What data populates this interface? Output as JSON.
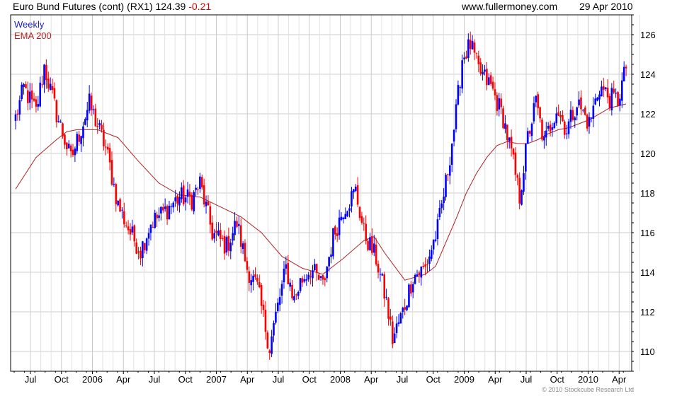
{
  "header": {
    "title": "Euro Bund Futures (cont) (RX1) 124.39",
    "change": "-0.21",
    "site": "www.fullermoney.com",
    "date": "29 Apr 2010"
  },
  "legend": [
    {
      "label": "Weekly",
      "color": "#1f1fbf"
    },
    {
      "label": "EMA 200",
      "color": "#b22222"
    }
  ],
  "copyright": "© 2010 Stockcube Research Ltd",
  "colors": {
    "up": "#0000ff",
    "down": "#ff0000",
    "ema": "#b22222",
    "grid": "#cccccc"
  },
  "chart_data": {
    "type": "candlestick",
    "title": "Euro Bund Futures (cont) (RX1)",
    "ylim": [
      109,
      127
    ],
    "y_ticks": [
      110,
      112,
      114,
      116,
      118,
      120,
      122,
      124,
      126
    ],
    "x_tick_labels": [
      "Jul",
      "Oct",
      "2006",
      "Apr",
      "Jul",
      "Oct",
      "2007",
      "Apr",
      "Jul",
      "Oct",
      "2008",
      "Apr",
      "Jul",
      "Oct",
      "2009",
      "Apr",
      "Jul",
      "Oct",
      "2010",
      "Apr"
    ],
    "grid": true,
    "legend_position": "top-left",
    "series": [
      {
        "name": "Weekly",
        "kind": "candles",
        "close_anchors": [
          {
            "t": 0,
            "v": 121.8
          },
          {
            "t": 4,
            "v": 123.3
          },
          {
            "t": 10,
            "v": 122.1
          },
          {
            "t": 14,
            "v": 124.4
          },
          {
            "t": 20,
            "v": 122.0
          },
          {
            "t": 27,
            "v": 119.7
          },
          {
            "t": 36,
            "v": 122.5
          },
          {
            "t": 44,
            "v": 120.3
          },
          {
            "t": 50,
            "v": 117.4
          },
          {
            "t": 56,
            "v": 116.0
          },
          {
            "t": 61,
            "v": 115.1
          },
          {
            "t": 66,
            "v": 116.5
          },
          {
            "t": 72,
            "v": 117.0
          },
          {
            "t": 80,
            "v": 117.8
          },
          {
            "t": 86,
            "v": 117.7
          },
          {
            "t": 90,
            "v": 118.5
          },
          {
            "t": 96,
            "v": 116.0
          },
          {
            "t": 103,
            "v": 115.3
          },
          {
            "t": 108,
            "v": 116.5
          },
          {
            "t": 113,
            "v": 114.2
          },
          {
            "t": 118,
            "v": 113.2
          },
          {
            "t": 124,
            "v": 110.2
          },
          {
            "t": 127,
            "v": 111.8
          },
          {
            "t": 132,
            "v": 114.2
          },
          {
            "t": 136,
            "v": 112.6
          },
          {
            "t": 139,
            "v": 113.5
          },
          {
            "t": 144,
            "v": 114.2
          },
          {
            "t": 150,
            "v": 113.3
          },
          {
            "t": 155,
            "v": 115.8
          },
          {
            "t": 160,
            "v": 117.2
          },
          {
            "t": 166,
            "v": 118.1
          },
          {
            "t": 170,
            "v": 116.0
          },
          {
            "t": 176,
            "v": 114.7
          },
          {
            "t": 181,
            "v": 112.5
          },
          {
            "t": 184,
            "v": 110.6
          },
          {
            "t": 189,
            "v": 112.0
          },
          {
            "t": 194,
            "v": 113.8
          },
          {
            "t": 200,
            "v": 114.2
          },
          {
            "t": 206,
            "v": 116.2
          },
          {
            "t": 210,
            "v": 118.5
          },
          {
            "t": 215,
            "v": 122.0
          },
          {
            "t": 218,
            "v": 124.8
          },
          {
            "t": 222,
            "v": 125.5
          },
          {
            "t": 226,
            "v": 124.2
          },
          {
            "t": 232,
            "v": 123.4
          },
          {
            "t": 238,
            "v": 121.8
          },
          {
            "t": 242,
            "v": 120.0
          },
          {
            "t": 246,
            "v": 117.8
          },
          {
            "t": 250,
            "v": 120.8
          },
          {
            "t": 254,
            "v": 122.6
          },
          {
            "t": 258,
            "v": 120.5
          },
          {
            "t": 264,
            "v": 122.3
          },
          {
            "t": 269,
            "v": 121.2
          },
          {
            "t": 274,
            "v": 122.6
          },
          {
            "t": 280,
            "v": 121.5
          },
          {
            "t": 285,
            "v": 123.4
          },
          {
            "t": 290,
            "v": 122.8
          },
          {
            "t": 294,
            "v": 122.7
          },
          {
            "t": 298,
            "v": 124.3
          }
        ]
      },
      {
        "name": "EMA 200",
        "kind": "line",
        "points": [
          {
            "t": 0,
            "v": 118.2
          },
          {
            "t": 10,
            "v": 119.8
          },
          {
            "t": 20,
            "v": 120.7
          },
          {
            "t": 25,
            "v": 121.1
          },
          {
            "t": 30,
            "v": 121.2
          },
          {
            "t": 40,
            "v": 121.2
          },
          {
            "t": 50,
            "v": 120.8
          },
          {
            "t": 60,
            "v": 119.6
          },
          {
            "t": 70,
            "v": 118.5
          },
          {
            "t": 80,
            "v": 117.9
          },
          {
            "t": 90,
            "v": 117.8
          },
          {
            "t": 100,
            "v": 117.3
          },
          {
            "t": 110,
            "v": 116.8
          },
          {
            "t": 120,
            "v": 116.0
          },
          {
            "t": 130,
            "v": 114.8
          },
          {
            "t": 140,
            "v": 114.2
          },
          {
            "t": 150,
            "v": 113.9
          },
          {
            "t": 160,
            "v": 114.7
          },
          {
            "t": 170,
            "v": 115.6
          },
          {
            "t": 175,
            "v": 115.8
          },
          {
            "t": 180,
            "v": 115.0
          },
          {
            "t": 190,
            "v": 113.6
          },
          {
            "t": 200,
            "v": 113.9
          },
          {
            "t": 205,
            "v": 114.3
          },
          {
            "t": 210,
            "v": 115.5
          },
          {
            "t": 215,
            "v": 116.7
          },
          {
            "t": 220,
            "v": 118.0
          },
          {
            "t": 225,
            "v": 119.0
          },
          {
            "t": 230,
            "v": 119.8
          },
          {
            "t": 235,
            "v": 120.4
          },
          {
            "t": 240,
            "v": 120.6
          },
          {
            "t": 245,
            "v": 120.5
          },
          {
            "t": 250,
            "v": 120.5
          },
          {
            "t": 255,
            "v": 120.7
          },
          {
            "t": 260,
            "v": 121.0
          },
          {
            "t": 265,
            "v": 121.2
          },
          {
            "t": 270,
            "v": 121.3
          },
          {
            "t": 280,
            "v": 121.7
          },
          {
            "t": 290,
            "v": 122.3
          },
          {
            "t": 298,
            "v": 122.5
          }
        ]
      }
    ]
  }
}
